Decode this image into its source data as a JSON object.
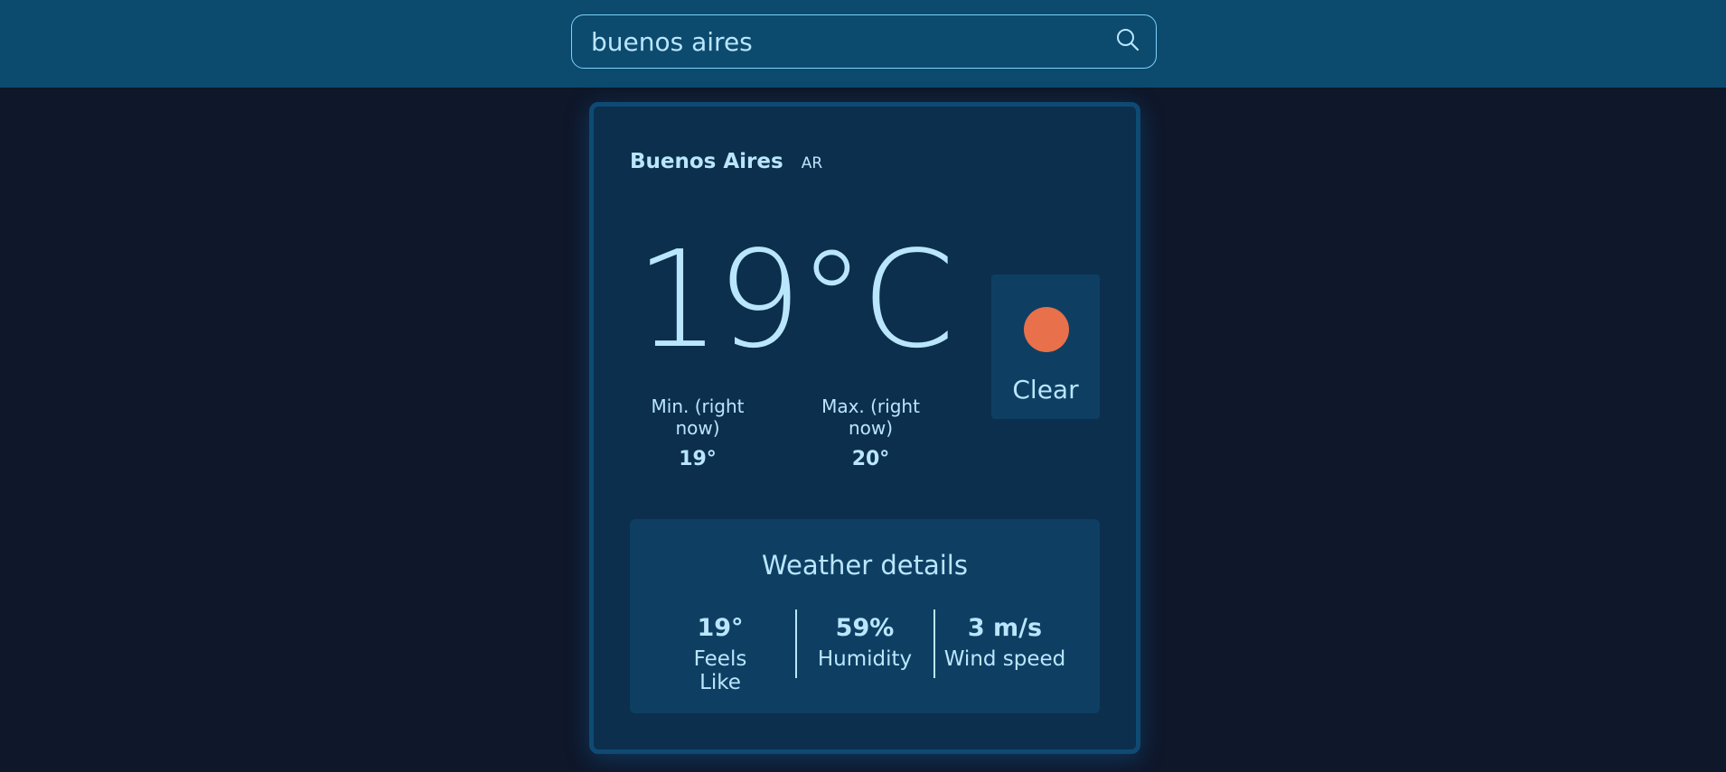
{
  "search": {
    "value": "buenos aires",
    "icon": "search-icon"
  },
  "location": {
    "city": "Buenos Aires",
    "country": "AR"
  },
  "current": {
    "temperature": "19°C",
    "min_label": "Min. (right now)",
    "min_value": "19°",
    "max_label": "Max. (right now)",
    "max_value": "20°",
    "condition": "Clear",
    "condition_icon": "sun-icon"
  },
  "details": {
    "title": "Weather details",
    "items": [
      {
        "value": "19°",
        "label": "Feels Like"
      },
      {
        "value": "59%",
        "label": "Humidity"
      },
      {
        "value": "3 m/s",
        "label": "Wind speed"
      }
    ]
  },
  "colors": {
    "page_background": "#0f172a",
    "header_background": "#0c4a6e",
    "card_background": "#0c2f4d",
    "text": "#bae6fd",
    "sun": "#e8704a"
  }
}
